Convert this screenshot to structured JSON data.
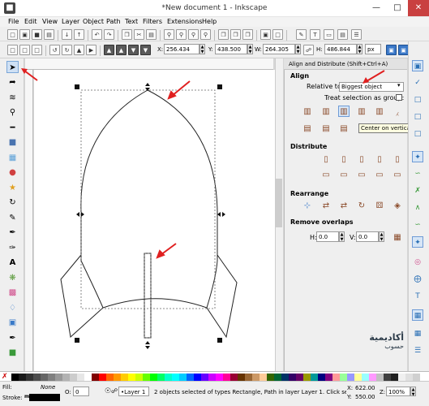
{
  "window": {
    "title": "*New document 1 - Inkscape"
  },
  "menu": [
    "File",
    "Edit",
    "View",
    "Layer",
    "Object",
    "Path",
    "Text",
    "Filters",
    "Extensions",
    "Help"
  ],
  "controls": {
    "x_label": "X:",
    "x_value": "256.434",
    "y_label": "Y:",
    "y_value": "438.500",
    "w_label": "W:",
    "w_value": "264.305",
    "h_label": "H:",
    "h_value": "486.844",
    "unit": "px"
  },
  "dock": {
    "title": "Align and Distribute (Shift+Ctrl+A)",
    "align_heading": "Align",
    "relative_label": "Relative to:",
    "relative_value": "Biggest object",
    "treat_group_label": "Treat selection as group:",
    "distribute_heading": "Distribute",
    "rearrange_heading": "Rearrange",
    "overlaps_heading": "Remove overlaps",
    "h_label": "H:",
    "h_value": "0.0",
    "v_label": "V:",
    "v_value": "0.0",
    "tooltip": "Center on vertical axis"
  },
  "status": {
    "fill_label": "Fill:",
    "fill_value": "None",
    "stroke_label": "Stroke:",
    "opacity_label": "O:",
    "opacity_value": "0",
    "layer": "•Layer 1",
    "message": "2 objects selected of types Rectangle, Path in layer Layer 1. Click selecti",
    "x_label": "X:",
    "x_value": "622.00",
    "y_label": "Y:",
    "y_value": "550.00",
    "z_label": "Z:",
    "zoom": "100%"
  },
  "watermark": {
    "line1": "أكاديمية",
    "line2": "حسوب"
  },
  "palette": [
    "#000000",
    "#1a1a1a",
    "#333333",
    "#4d4d4d",
    "#666666",
    "#808080",
    "#999999",
    "#b3b3b3",
    "#cccccc",
    "#e6e6e6",
    "#ffffff",
    "#800000",
    "#ff0000",
    "#ff6600",
    "#ff9900",
    "#ffcc00",
    "#ffff00",
    "#ccff00",
    "#66ff00",
    "#00ff00",
    "#00ff66",
    "#00ffcc",
    "#00ffff",
    "#00ccff",
    "#0066ff",
    "#0000ff",
    "#6600ff",
    "#cc00ff",
    "#ff00ff",
    "#ff0099",
    "#990033",
    "#663300",
    "#996633",
    "#cc9966",
    "#ffcc99",
    "#336600",
    "#006633",
    "#003366",
    "#330066",
    "#660066",
    "#999900",
    "#009999",
    "#000080",
    "#800080",
    "#ff9999",
    "#99ff99",
    "#9999ff",
    "#ffff99",
    "#99ffff",
    "#ff99ff",
    "#c0c0c0",
    "#404040",
    "#202020",
    "#f0f0f0",
    "#e0e0e0",
    "#d0d0d0"
  ]
}
